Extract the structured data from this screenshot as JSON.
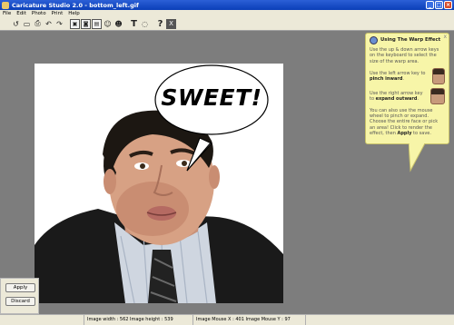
{
  "window": {
    "title": "Caricature Studio 2.0 - bottom_left.gif",
    "controls": [
      "_",
      "□",
      "×"
    ]
  },
  "menu": [
    "File",
    "Edit",
    "Photo",
    "Print",
    "Help"
  ],
  "toolbar": {
    "tools": [
      "open-icon",
      "save-icon",
      "print-icon",
      "undo-icon",
      "redo-icon",
      "frame-icon",
      "stamp-icon",
      "photo-icon",
      "morph-icon",
      "face-icon",
      "text-tool-icon",
      "speech-icon",
      "help-icon",
      "close-tool-icon"
    ],
    "text_tool_label": "T",
    "help_label": "?",
    "x_label": "X"
  },
  "canvas": {
    "speech_bubble_text": "SWEET!"
  },
  "help_panel": {
    "title": "Using The Warp Effect",
    "close_label": "x",
    "intro": "Use the up & down arrow keys on the keyboard to select the size of the warp area.",
    "pinch_pre": "Use the left arrow key to ",
    "pinch_bold": "pinch inward",
    "pinch_post": ".",
    "expand_pre": "Use the right arrow key to ",
    "expand_bold": "expand outward",
    "expand_post": ".",
    "outro_pre": "You can also use the mouse wheel to pinch or expand. Choose the entire face or pick an area! Click to render the effect, then ",
    "outro_bold": "Apply",
    "outro_post": " to save."
  },
  "side_panel": {
    "apply_label": "Apply",
    "discard_label": "Discard"
  },
  "status": {
    "image_size": "Image width : 562  Image height : 539",
    "mouse_pos": "Image Mouse X : 401  Image Mouse Y : 97"
  },
  "colors": {
    "background": "#7d7d7d",
    "help_panel_bg": "#f7f5a8",
    "title_bar": "#0a3fb8"
  }
}
